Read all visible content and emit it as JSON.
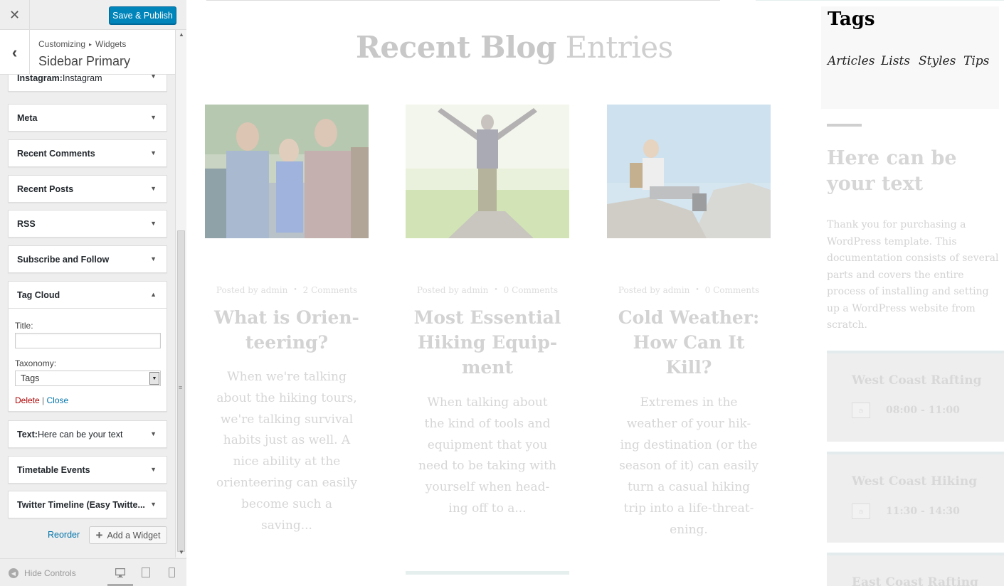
{
  "customizer": {
    "close_glyph": "✕",
    "save_label": "Save & Publish",
    "back_glyph": "‹",
    "breadcrumb": {
      "root": "Customizing",
      "sep": "▸",
      "current": "Widgets"
    },
    "section_title": "Sidebar Primary",
    "widgets": [
      {
        "name": "Instagram:",
        "sub": " Instagram"
      },
      {
        "name": "Meta",
        "sub": ""
      },
      {
        "name": "Recent Comments",
        "sub": ""
      },
      {
        "name": "Recent Posts",
        "sub": ""
      },
      {
        "name": "RSS",
        "sub": ""
      },
      {
        "name": "Subscribe and Follow",
        "sub": ""
      },
      {
        "name": "Tag Cloud",
        "sub": ""
      },
      {
        "name": "Text:",
        "sub": " Here can be your text"
      },
      {
        "name": "Timetable Events",
        "sub": ""
      },
      {
        "name": "Twitter Timeline (Easy Twitte...",
        "sub": ""
      }
    ],
    "tag_cloud_form": {
      "title_label": "Title:",
      "title_value": "",
      "taxonomy_label": "Taxonomy:",
      "taxonomy_value": "Tags",
      "delete_label": "Delete",
      "link_sep": " | ",
      "close_label": "Close"
    },
    "reorder_label": "Reorder",
    "add_widget_label": "Add a Widget",
    "hide_controls_label": "Hide Controls",
    "active_device": "desktop"
  },
  "preview": {
    "heading_bold": "Recent Blog",
    "heading_light": " Entries",
    "posts": [
      {
        "posted_by": "Posted by",
        "author": "admin",
        "comments": "2 Comments",
        "title": "What is Orien-teering?",
        "excerpt": "When we're talking about the hiking tours, we're talking survival habits just as well. A nice ability at the orienteering can easily become such a saving..."
      },
      {
        "posted_by": "Posted by",
        "author": "admin",
        "comments": "0 Comments",
        "title": "Most Essential Hiking Equip-ment",
        "excerpt": "When talking about the kind of tools and equipment that you need to be taking with yourself when head-ing off to a..."
      },
      {
        "posted_by": "Posted by",
        "author": "admin",
        "comments": "0 Comments",
        "title": "Cold Weather: How Can It Kill?",
        "excerpt": "Extremes in the weather of your hik-ing destination (or the season of it) can easily turn a casual hiking trip into a life-threat-ening."
      }
    ],
    "tags_widget": {
      "title": "Tags",
      "tags": [
        "Articles",
        "Lists",
        "Styles",
        "Tips"
      ]
    },
    "text_widget": {
      "title": "Here can be your text",
      "body": "Thank you for purchasing a WordPress template. This documentation consists of several parts and covers the entire process of installing and setting up a WordPress website from scratch."
    },
    "timetable": [
      {
        "title": "West Coast Rafting",
        "time": "08:00 - 11:00"
      },
      {
        "title": "West Coast Hiking",
        "time": "11:30 - 14:30"
      },
      {
        "title": "East Coast Rafting",
        "time": ""
      }
    ]
  },
  "colors": {
    "primary_button": "#0085ba",
    "link": "#0073aa",
    "delete_link": "#a00000",
    "panel_bg": "#eeeeee"
  }
}
